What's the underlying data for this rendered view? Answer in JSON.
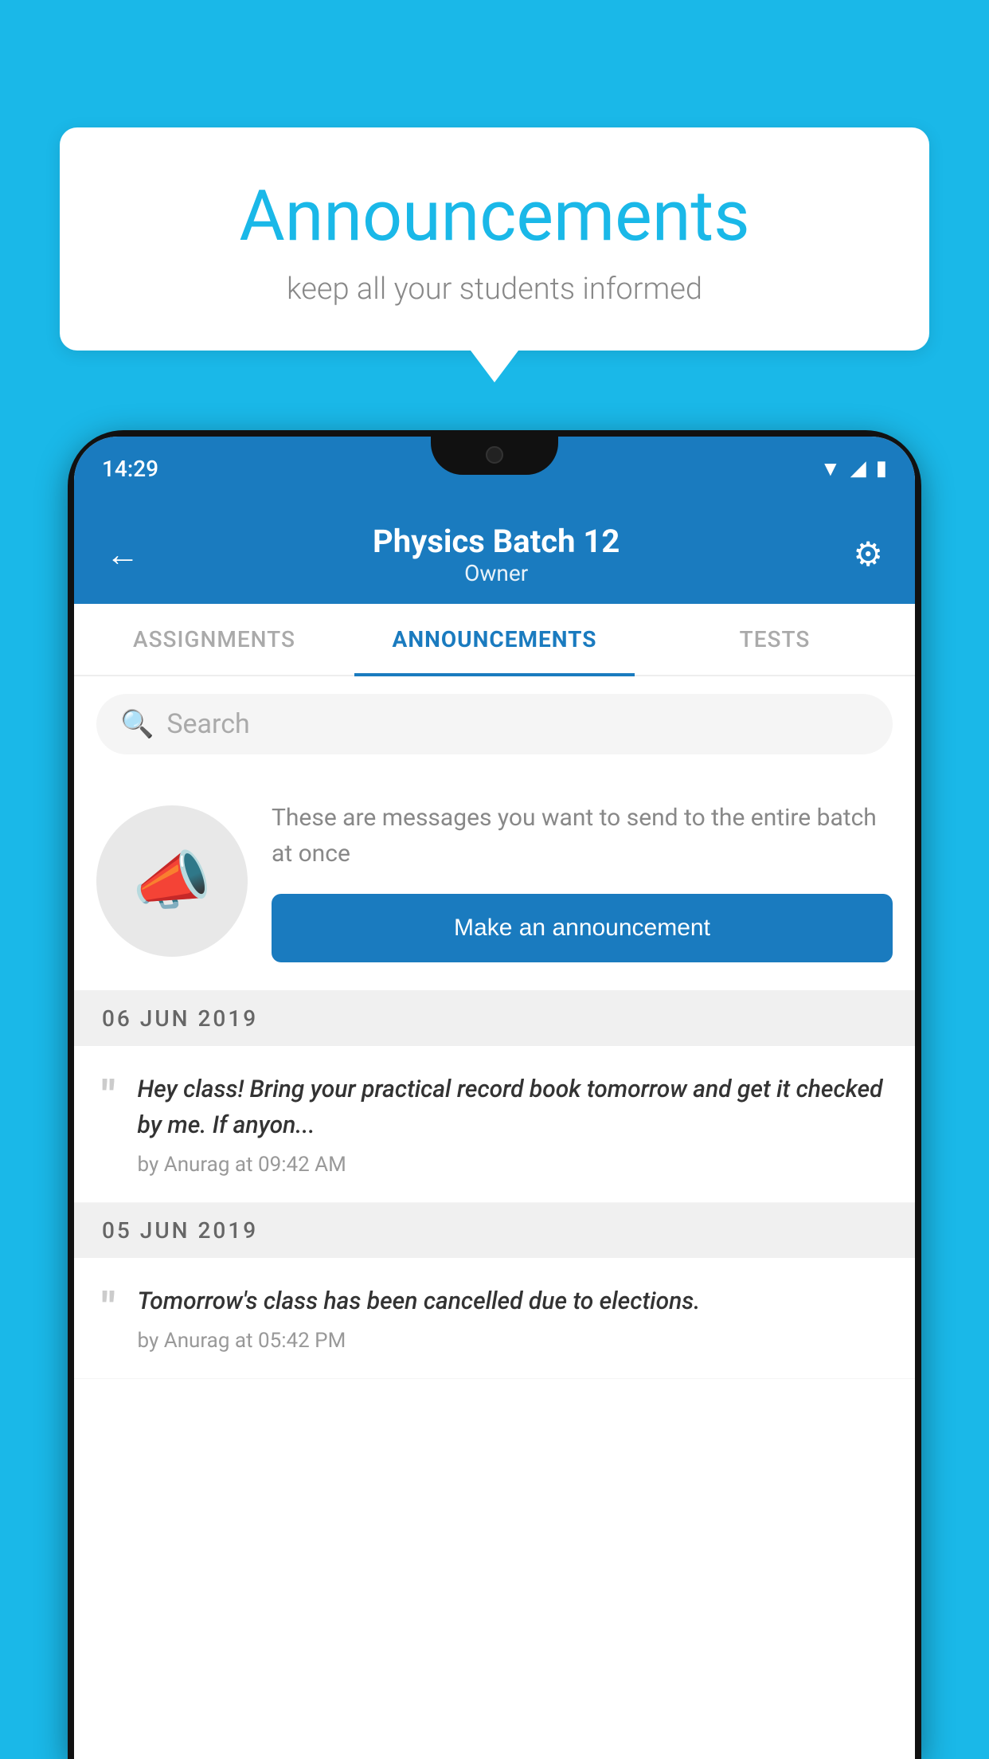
{
  "background": {
    "color": "#1ab8e8"
  },
  "speech_bubble": {
    "title": "Announcements",
    "subtitle": "keep all your students informed"
  },
  "phone": {
    "status_bar": {
      "time": "14:29"
    },
    "header": {
      "title": "Physics Batch 12",
      "subtitle": "Owner",
      "back_label": "←",
      "gear_label": "⚙"
    },
    "tabs": [
      {
        "label": "ASSIGNMENTS",
        "active": false
      },
      {
        "label": "ANNOUNCEMENTS",
        "active": true
      },
      {
        "label": "TESTS",
        "active": false
      }
    ],
    "search": {
      "placeholder": "Search"
    },
    "announcement_prompt": {
      "description": "These are messages you want to send to the entire batch at once",
      "button_label": "Make an announcement"
    },
    "announcements": [
      {
        "date": "06  JUN  2019",
        "messages": [
          {
            "text": "Hey class! Bring your practical record book tomorrow and get it checked by me. If anyon...",
            "author": "by Anurag at 09:42 AM"
          }
        ]
      },
      {
        "date": "05  JUN  2019",
        "messages": [
          {
            "text": "Tomorrow's class has been cancelled due to elections.",
            "author": "by Anurag at 05:42 PM"
          }
        ]
      }
    ]
  }
}
